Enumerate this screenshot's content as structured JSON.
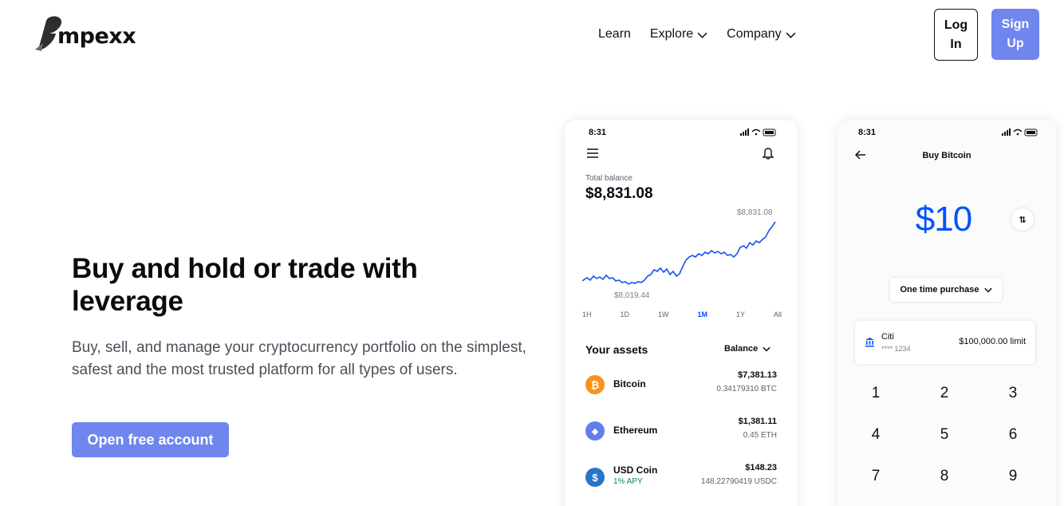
{
  "brand": {
    "logo_text": "mpexx",
    "logo_letter": "e"
  },
  "nav": {
    "items": [
      {
        "label": "Learn",
        "dropdown": false
      },
      {
        "label": "Explore",
        "dropdown": true
      },
      {
        "label": "Company",
        "dropdown": true
      }
    ],
    "login_label": "Log In",
    "signup_label": "Sign Up"
  },
  "hero": {
    "title": "Buy and hold or trade with leverage",
    "subtitle": "Buy, sell, and manage your cryptocurrency portfolio on the simplest, safest and the most trusted platform for all types of users.",
    "cta_label": "Open free account"
  },
  "colors": {
    "accent": "#6f86ee",
    "phone_blue": "#0052ff",
    "chart_line": "#1652f0"
  },
  "phone_portfolio": {
    "time": "8:31",
    "balance_label": "Total balance",
    "balance": "$8,831.08",
    "chart_max": "$8,831.08",
    "chart_min": "$8,019.44",
    "ranges": [
      "1H",
      "1D",
      "1W",
      "1M",
      "1Y",
      "All"
    ],
    "active_range": "1M",
    "assets_title": "Your assets",
    "sort_label": "Balance",
    "assets": [
      {
        "name": "Bitcoin",
        "sub": "",
        "value": "$7,381.13",
        "amount": "0.34179310 BTC",
        "icon": "bitcoin-icon",
        "color": "#f7931a",
        "glyph": "₿"
      },
      {
        "name": "Ethereum",
        "sub": "",
        "value": "$1,381.11",
        "amount": "0.45 ETH",
        "icon": "ethereum-icon",
        "color": "#627eea",
        "glyph": "◆"
      },
      {
        "name": "USD Coin",
        "sub": "1% APY",
        "value": "$148.23",
        "amount": "148.22790419 USDC",
        "icon": "usdc-icon",
        "color": "#2775ca",
        "glyph": "$"
      }
    ]
  },
  "phone_buy": {
    "time": "8:31",
    "title": "Buy Bitcoin",
    "amount": "$10",
    "swap_glyph": "⇅",
    "purchase_type": "One time purchase",
    "bank_name": "Citi",
    "bank_number": "**** 1234",
    "limit": "$100,000.00 limit",
    "keys": [
      "1",
      "2",
      "3",
      "4",
      "5",
      "6",
      "7",
      "8",
      "9"
    ]
  }
}
